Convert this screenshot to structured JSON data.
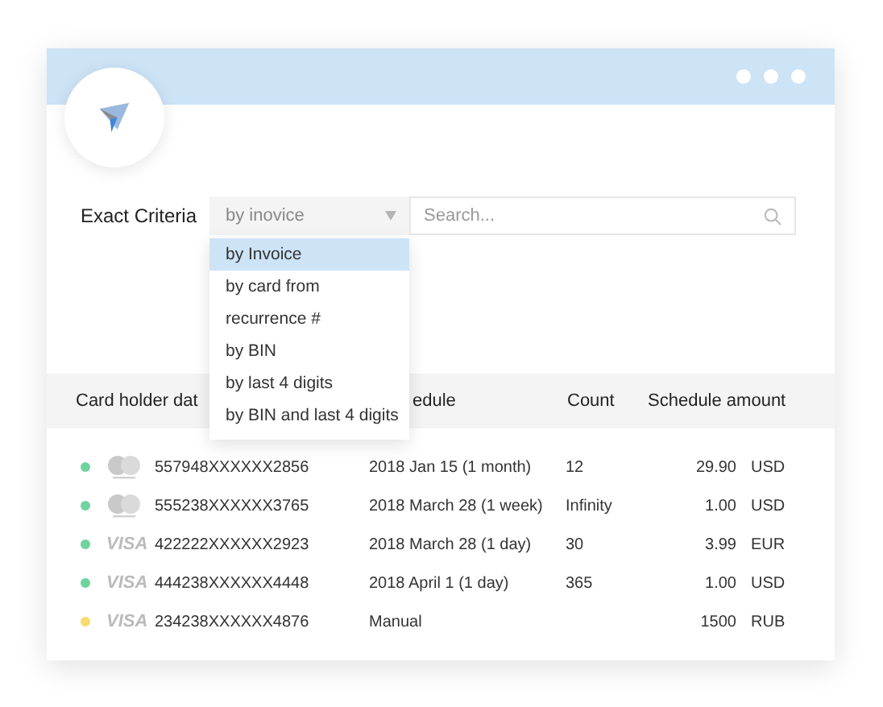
{
  "filter": {
    "label": "Exact Criteria",
    "select_value": "by inovice",
    "search": {
      "placeholder": "Search..."
    },
    "dropdown": [
      {
        "label": "by Invoice",
        "selected": true
      },
      {
        "label": "by card from",
        "selected": false
      },
      {
        "label": "recurrence #",
        "selected": false
      },
      {
        "label": "by BIN",
        "selected": false
      },
      {
        "label": "by last 4 digits",
        "selected": false
      },
      {
        "label": "by BIN and last 4 digits",
        "selected": false
      }
    ]
  },
  "table": {
    "columns": [
      "Card holder dat",
      "edule",
      "Count",
      "Schedule amount"
    ],
    "rows": [
      {
        "color": "#6fd3a0",
        "card": {
          "kind": "mastercard"
        },
        "number": "557948XXXXXX2856",
        "schedule": "2018 Jan 15 (1 month)",
        "count": "12",
        "amount": "29.90",
        "currency": "USD"
      },
      {
        "color": "#6fd3a0",
        "card": {
          "kind": "mastercard"
        },
        "number": "555238XXXXXX3765",
        "schedule": "2018 March 28 (1 week)",
        "count": "Infinity",
        "amount": "1.00",
        "currency": "USD"
      },
      {
        "color": "#6fd3a0",
        "card": {
          "kind": "visa",
          "label": "VISA"
        },
        "number": "422222XXXXXX2923",
        "schedule": "2018 March 28 (1 day)",
        "count": "30",
        "amount": "3.99",
        "currency": "EUR"
      },
      {
        "color": "#6fd3a0",
        "card": {
          "kind": "visa",
          "label": "VISA"
        },
        "number": "444238XXXXXX4448",
        "schedule": "2018 April 1 (1 day)",
        "count": "365",
        "amount": "1.00",
        "currency": "USD"
      },
      {
        "color": "#f7dc6f",
        "card": {
          "kind": "visa",
          "label": "VISA"
        },
        "number": "234238XXXXXX4876",
        "schedule": "Manual",
        "count": "",
        "amount": "1500",
        "currency": "RUB"
      }
    ]
  }
}
